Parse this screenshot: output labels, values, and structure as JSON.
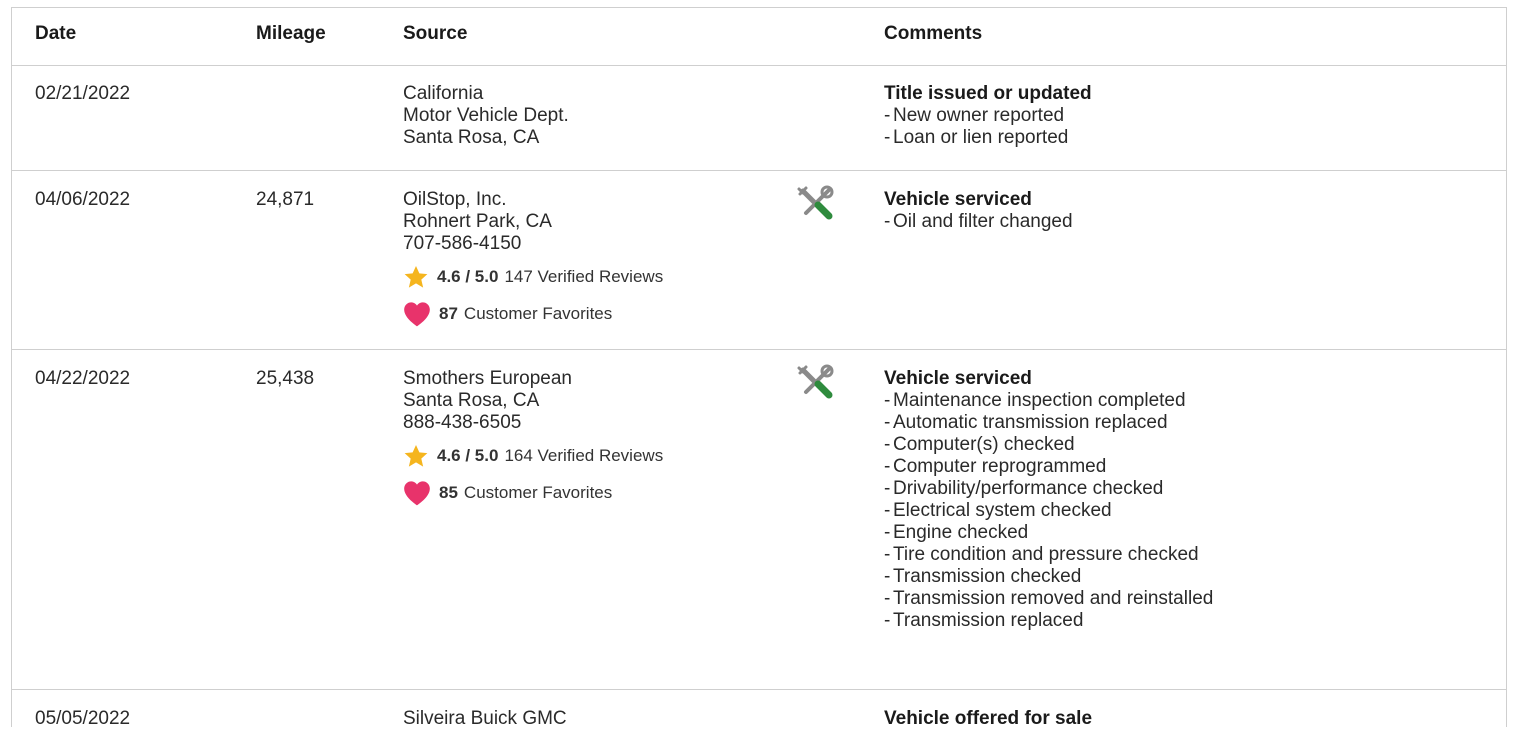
{
  "table": {
    "headers": {
      "date": "Date",
      "mileage": "Mileage",
      "source": "Source",
      "comments": "Comments"
    },
    "rows": [
      {
        "date": "02/21/2022",
        "mileage": "",
        "source": [
          "California",
          "Motor Vehicle Dept.",
          "Santa Rosa, CA"
        ],
        "icon": "",
        "comment_title": "Title issued or updated",
        "comment_items": [
          "New owner reported",
          "Loan or lien reported"
        ]
      },
      {
        "date": "04/06/2022",
        "mileage": "24,871",
        "source": [
          "OilStop, Inc.",
          "Rohnert Park, CA",
          "707-586-4150"
        ],
        "rating": {
          "score": "4.6 / 5.0",
          "reviews": "147 Verified Reviews"
        },
        "favorites": {
          "count": "87",
          "label": "Customer Favorites"
        },
        "icon": "tools-icon",
        "comment_title": "Vehicle serviced",
        "comment_items": [
          "Oil and filter changed"
        ]
      },
      {
        "date": "04/22/2022",
        "mileage": "25,438",
        "source": [
          "Smothers European",
          "Santa Rosa, CA",
          "888-438-6505"
        ],
        "rating": {
          "score": "4.6 / 5.0",
          "reviews": "164 Verified Reviews"
        },
        "favorites": {
          "count": "85",
          "label": "Customer Favorites"
        },
        "icon": "tools-icon",
        "comment_title": "Vehicle serviced",
        "comment_items": [
          "Maintenance inspection completed",
          "Automatic transmission replaced",
          "Computer(s) checked",
          "Computer reprogrammed",
          "Drivability/performance checked",
          "Electrical system checked",
          "Engine checked",
          "Tire condition and pressure checked",
          "Transmission checked",
          "Transmission removed and reinstalled",
          "Transmission replaced"
        ]
      },
      {
        "date": "05/05/2022",
        "mileage": "",
        "source": [
          "Silveira Buick GMC"
        ],
        "icon": "",
        "comment_title": "Vehicle offered for sale",
        "comment_items": []
      }
    ]
  },
  "colors": {
    "star": "#f5b51e",
    "heart": "#e8336b",
    "wrench": "#8a8a8a",
    "screwdriver": "#2e8b3d",
    "border": "#cfcfcf"
  }
}
